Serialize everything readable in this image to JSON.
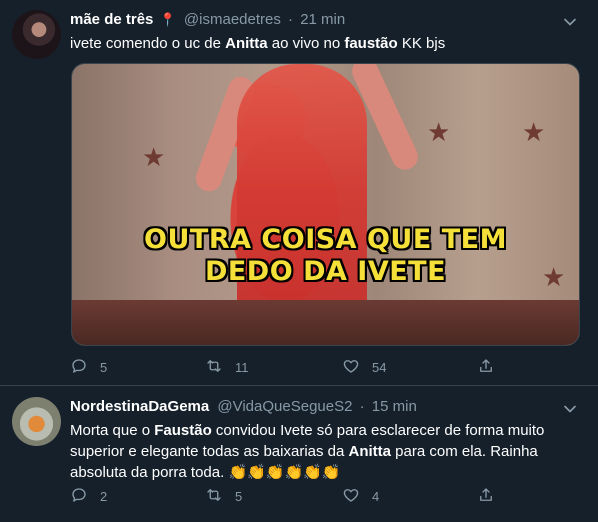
{
  "tweets": [
    {
      "name": "mãe de três",
      "pin": "📍",
      "handle": "@ismaedetres",
      "time": "21 min",
      "text_parts": [
        "ivete comendo o uc de ",
        "Anitta",
        " ao vivo no ",
        "faustão",
        " KK bjs"
      ],
      "media": {
        "caption_line_1": "OUTRA COISA QUE TEM",
        "caption_line_2": "DEDO DA IVETE"
      },
      "replies": "5",
      "retweets": "11",
      "likes": "54"
    },
    {
      "name": "NordestinaDaGema",
      "handle": "@VidaQueSegueS2",
      "time": "15 min",
      "text_parts": [
        "Morta que o ",
        "Faustão",
        " convidou Ivete só para esclarecer de forma muito superior e elegante todas as baixarias da ",
        "Anitta",
        " para com ela. Rainha absoluta da porra toda. ",
        "👏👏👏👏👏👏"
      ],
      "replies": "2",
      "retweets": "5",
      "likes": "4"
    }
  ],
  "separator": "·",
  "icons": {
    "caret": "chevron-down-icon",
    "reply": "reply-icon",
    "retweet": "retweet-icon",
    "like": "heart-icon",
    "share": "share-icon"
  },
  "colors": {
    "background": "#15202b",
    "text": "#ffffff",
    "muted": "#8899a6",
    "border": "#38444d",
    "caption": "#f5e03a"
  }
}
